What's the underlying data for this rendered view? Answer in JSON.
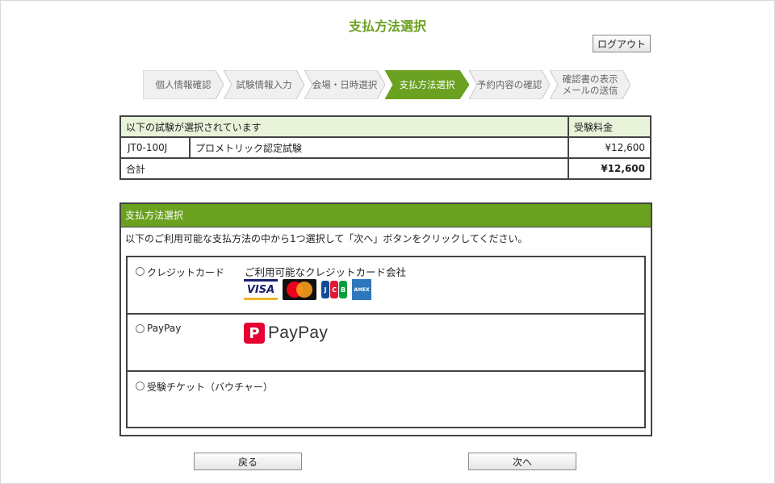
{
  "page": {
    "title": "支払方法選択",
    "logout_label": "ログアウト"
  },
  "steps": [
    {
      "label": "個人情報確認",
      "state": "done"
    },
    {
      "label": "試験情報入力",
      "state": "done"
    },
    {
      "label": "会場・日時選択",
      "state": "done"
    },
    {
      "label": "支払方法選択",
      "state": "active"
    },
    {
      "label": "予約内容の確認",
      "state": "todo"
    },
    {
      "label_line1": "確認書の表示",
      "label_line2": "メールの送信",
      "state": "todo"
    }
  ],
  "fees_table": {
    "header": "以下の試験が選択されています",
    "fee_header": "受験料金",
    "rows": [
      {
        "code": "JT0-100J",
        "name": "プロメトリック認定試験",
        "price": "¥12,600"
      }
    ],
    "total_label": "合計",
    "total_price": "¥12,600"
  },
  "payment": {
    "header": "支払方法選択",
    "instruction": "以下のご利用可能な支払方法の中から1つ選択して「次へ」ボタンをクリックしてください。",
    "options": [
      {
        "label": "クレジットカード",
        "detail": "ご利用可能なクレジットカード会社",
        "logos": [
          "visa-logo",
          "mastercard-logo",
          "jcb-logo",
          "amex-logo"
        ]
      },
      {
        "label": "PayPay",
        "logo_text": "PayPay",
        "logo_icon": "P"
      },
      {
        "label": "受験チケット（バウチャー）"
      }
    ]
  },
  "buttons": {
    "back": "戻る",
    "next": "次へ"
  },
  "colors": {
    "brand_green": "#6aa120",
    "header_bg": "#e8f3da",
    "paypay_red": "#e60033"
  }
}
